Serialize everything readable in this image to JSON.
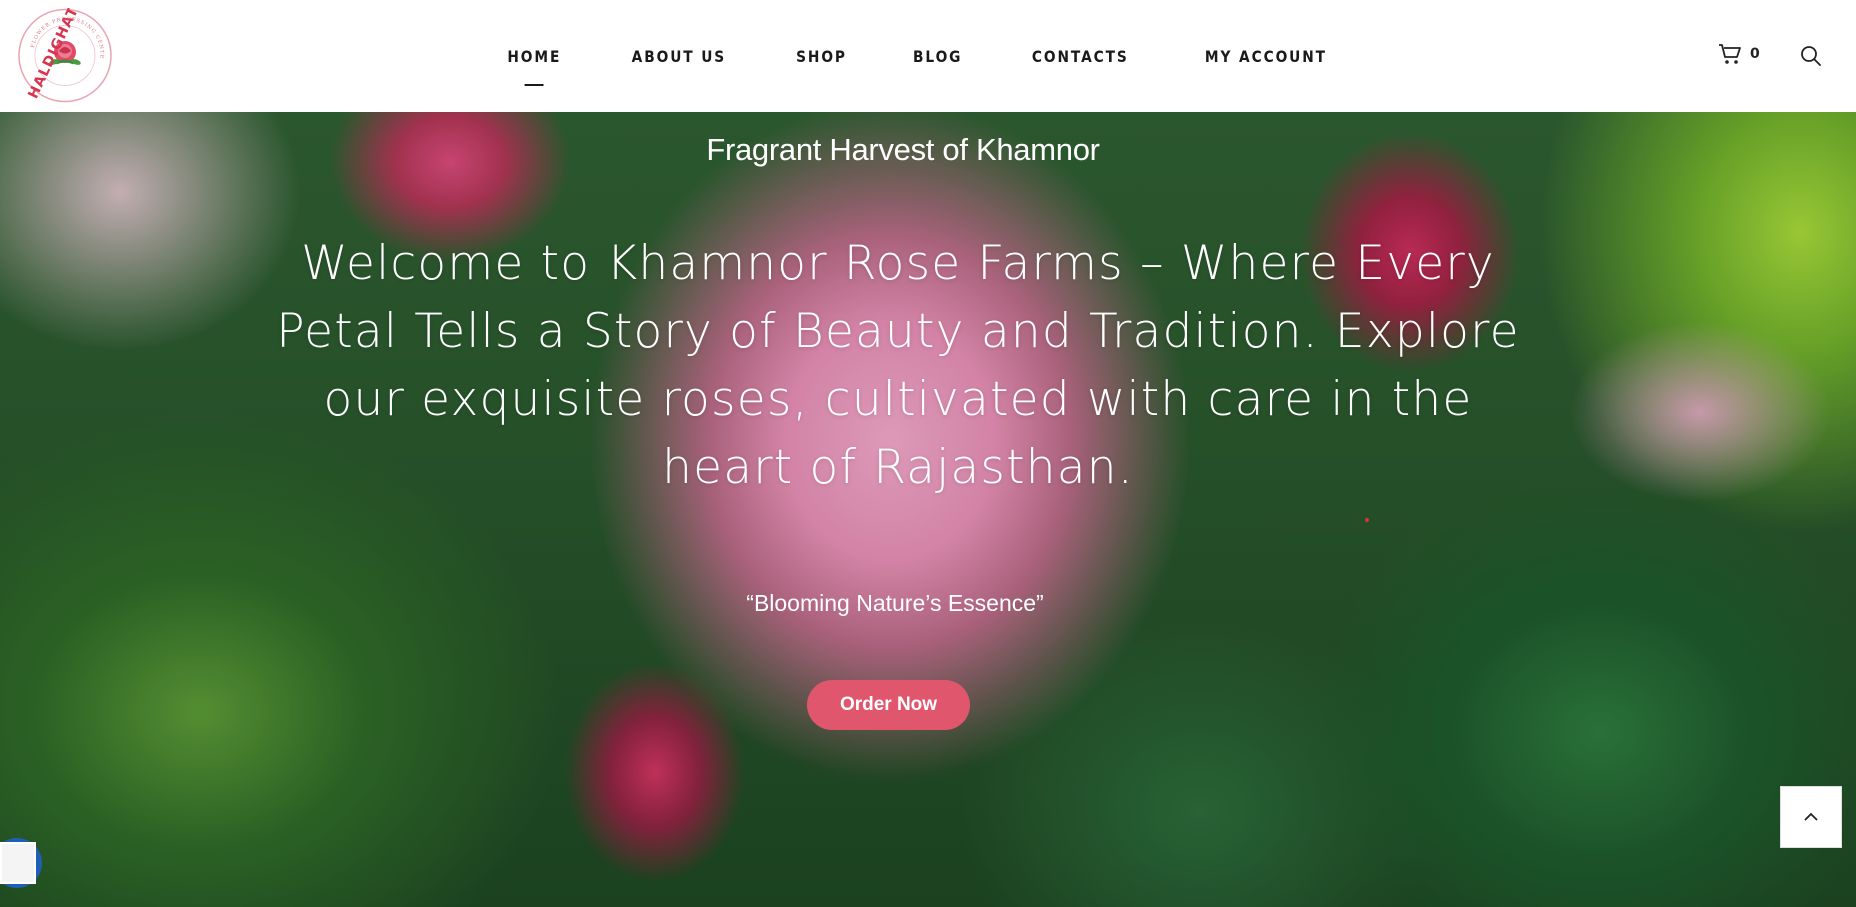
{
  "header": {
    "logo": {
      "brand_text": "HALDIGHATI",
      "ring_text": "FLOWER PROCESSING CENTER",
      "icon": "rose-icon"
    },
    "nav": [
      {
        "label": "HOME",
        "active": true
      },
      {
        "label": "ABOUT US",
        "active": false
      },
      {
        "label": "SHOP",
        "active": false
      },
      {
        "label": "BLOG",
        "active": false
      },
      {
        "label": "CONTACTS",
        "active": false
      },
      {
        "label": "MY ACCOUNT",
        "active": false
      }
    ],
    "cart_count": "0",
    "cart_icon": "cart-icon",
    "search_icon": "search-icon"
  },
  "hero": {
    "kicker": "Fragrant Harvest of Khamnor",
    "headline": "Welcome to Khamnor Rose Farms – Where Every Petal Tells a Story of Beauty and Tradition. Explore our exquisite roses, cultivated with care in the heart of Rajasthan.",
    "tagline": "“Blooming Nature’s Essence”",
    "cta_label": "Order Now",
    "background": "blurred-pink-rose-photo"
  },
  "widgets": {
    "scroll_top_icon": "chevron-up-icon",
    "language_widget_icon": "flag-icon"
  },
  "colors": {
    "accent": "#e0576d",
    "nav_text": "#1a1a1a",
    "logo_red": "#d8344f"
  }
}
